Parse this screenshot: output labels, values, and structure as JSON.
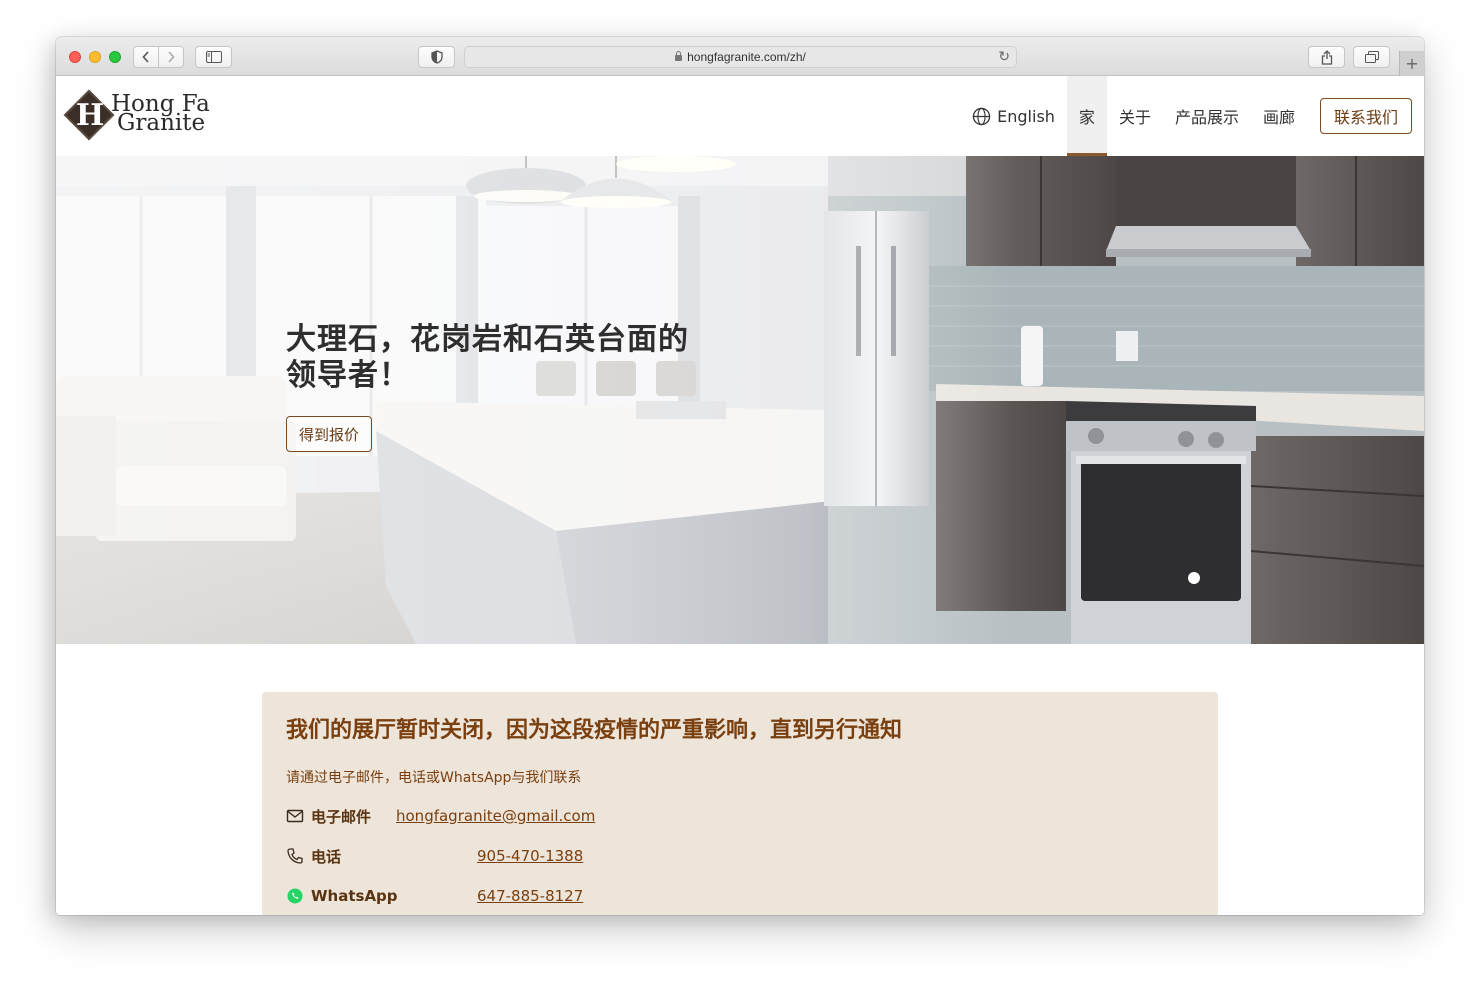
{
  "browser": {
    "url": "hongfagranite.com/zh/"
  },
  "logo": {
    "letter": "H",
    "line1": "Hong Fa",
    "line2": "Granite"
  },
  "nav": {
    "language": "English",
    "items": [
      {
        "label": "家",
        "active": true
      },
      {
        "label": "关于",
        "active": false
      },
      {
        "label": "产品展示",
        "active": false
      },
      {
        "label": "画廊",
        "active": false
      }
    ],
    "contact_label": "联系我们"
  },
  "hero": {
    "title": "大理石，花岗岩和石英台面的领导者！",
    "button_label": "得到报价"
  },
  "notice": {
    "title": "我们的展厅暂时关闭，因为这段疫情的严重影响，直到另行通知",
    "subtitle": "请通过电子邮件，电话或WhatsApp与我们联系",
    "contacts": [
      {
        "icon": "mail-icon",
        "label": "电子邮件",
        "value": "hongfagranite@gmail.com"
      },
      {
        "icon": "phone-icon",
        "label": "电话",
        "value": "905-470-1388"
      },
      {
        "icon": "whatsapp-icon",
        "label": "WhatsApp",
        "value": "647-885-8127"
      }
    ]
  },
  "colors": {
    "accent": "#7a4a1e",
    "notice_bg": "#ede4da",
    "whatsapp": "#25d366"
  }
}
